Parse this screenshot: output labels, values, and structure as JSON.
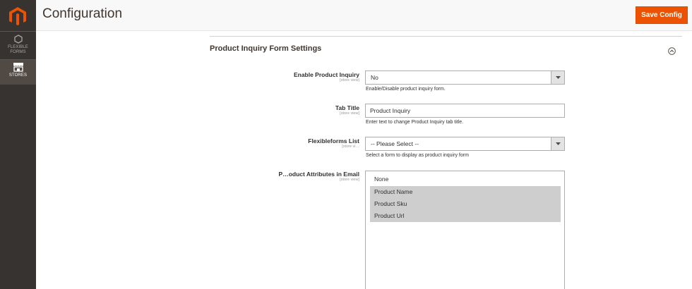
{
  "sidebar": {
    "logo_icon": "magento-logo-icon",
    "items": [
      {
        "label": "FLEXIBLE",
        "label2": "FORMS",
        "icon": "hexagon-icon",
        "active": false
      },
      {
        "label": "STORES",
        "label2": "",
        "icon": "store-icon",
        "active": true
      }
    ]
  },
  "header": {
    "title": "Configuration",
    "save_label": "Save Config"
  },
  "section": {
    "title": "Product Inquiry Form Settings",
    "collapse_icon": "circle-chevron-up-icon"
  },
  "fields": {
    "enable": {
      "label": "Enable Product Inquiry",
      "scope": "[store view]",
      "value": "No",
      "note": "Enable/Disable product inquiry form."
    },
    "tab_title": {
      "label": "Tab Title",
      "scope": "[store view]",
      "value": "Product Inquiry",
      "note": "Enter text to change Product Inquiry tab title."
    },
    "forms_list": {
      "label": "Flexibleforms List",
      "scope": "[store vi…",
      "value": "-- Please Select --",
      "note": "Select a form to display as product inquiry form"
    },
    "attributes": {
      "label": "P…oduct Attributes in Email",
      "scope": "[store view]",
      "options": [
        {
          "label": "None",
          "selected": false
        },
        {
          "label": "Product Name",
          "selected": true
        },
        {
          "label": "Product Sku",
          "selected": true
        },
        {
          "label": "Product Url",
          "selected": true
        }
      ]
    }
  },
  "colors": {
    "accent": "#eb5202",
    "sidebar_bg": "#373330",
    "sidebar_active": "#514943"
  }
}
